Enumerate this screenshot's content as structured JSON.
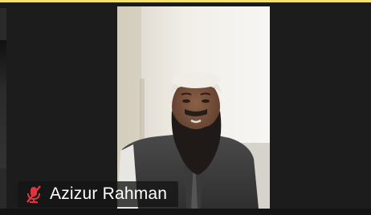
{
  "participant": {
    "name": "Azizur Rahman",
    "mic_state": "muted",
    "mic_icon": "mic-muted-icon"
  },
  "colors": {
    "active_speaker_highlight": "#f2e46a",
    "muted_icon": "#e0353a",
    "background": "#1a1a1a"
  }
}
